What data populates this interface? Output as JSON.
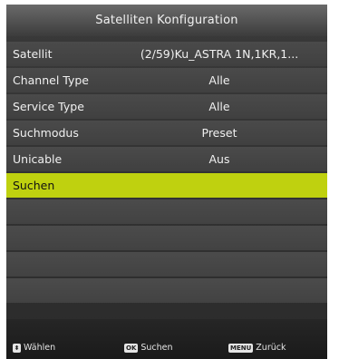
{
  "title": "Satelliten Konfiguration",
  "rows": [
    {
      "label": "Satellit",
      "value": "(2/59)Ku_ASTRA 1N,1KR,1..."
    },
    {
      "label": "Channel Type",
      "value": "Alle"
    },
    {
      "label": "Service Type",
      "value": "Alle"
    },
    {
      "label": "Suchmodus",
      "value": "Preset"
    },
    {
      "label": "Unicable",
      "value": "Aus"
    },
    {
      "label": "Suchen",
      "value": ""
    }
  ],
  "footer": {
    "select": {
      "key": "⬍",
      "label": "Wählen"
    },
    "ok": {
      "key": "OK",
      "label": "Suchen"
    },
    "menu": {
      "key": "MENU",
      "label": "Zurück"
    }
  },
  "colors": {
    "highlight": "#bfd10f",
    "row": "#464646",
    "background": "#2e2e2e"
  }
}
